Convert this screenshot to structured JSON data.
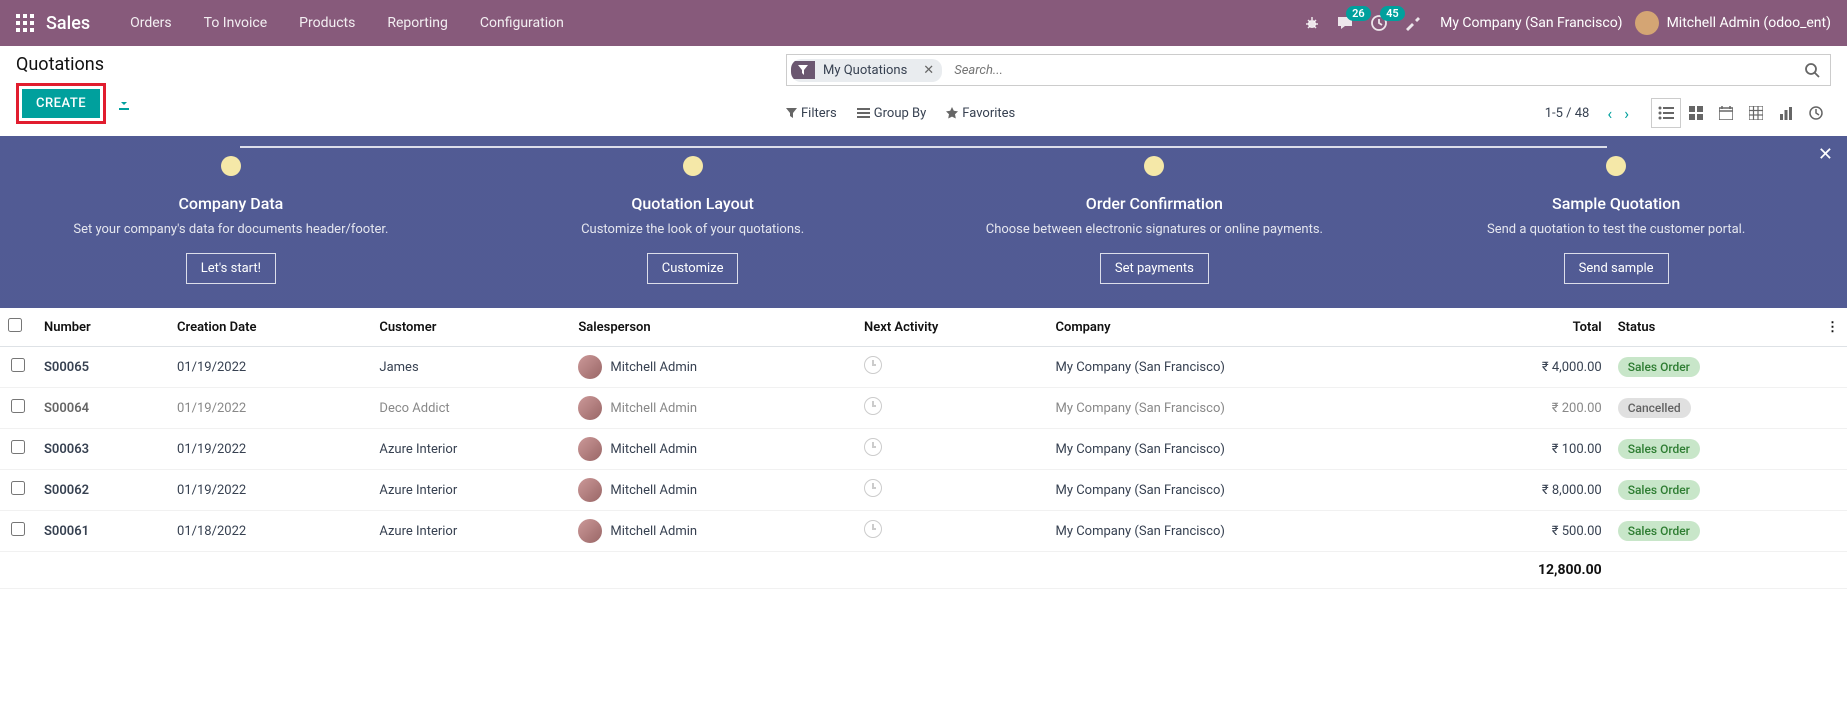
{
  "topnav": {
    "brand": "Sales",
    "menu": [
      "Orders",
      "To Invoice",
      "Products",
      "Reporting",
      "Configuration"
    ],
    "messages_badge": "26",
    "activities_badge": "45",
    "company": "My Company (San Francisco)",
    "user": "Mitchell Admin (odoo_ent)"
  },
  "cp": {
    "title": "Quotations",
    "create": "CREATE"
  },
  "search": {
    "chip": "My Quotations",
    "placeholder": "Search..."
  },
  "filters": {
    "filters": "Filters",
    "groupby": "Group By",
    "favorites": "Favorites",
    "pager": "1-5 / 48"
  },
  "onboard": {
    "steps": [
      {
        "title": "Company Data",
        "desc": "Set your company's data for documents header/footer.",
        "btn": "Let's start!"
      },
      {
        "title": "Quotation Layout",
        "desc": "Customize the look of your quotations.",
        "btn": "Customize"
      },
      {
        "title": "Order Confirmation",
        "desc": "Choose between electronic signatures or online payments.",
        "btn": "Set payments"
      },
      {
        "title": "Sample Quotation",
        "desc": "Send a quotation to test the customer portal.",
        "btn": "Send sample"
      }
    ]
  },
  "table": {
    "headers": {
      "number": "Number",
      "creation_date": "Creation Date",
      "customer": "Customer",
      "salesperson": "Salesperson",
      "next_activity": "Next Activity",
      "company": "Company",
      "total": "Total",
      "status": "Status"
    },
    "rows": [
      {
        "number": "S00065",
        "date": "01/19/2022",
        "customer": "James",
        "salesperson": "Mitchell Admin",
        "company": "My Company (San Francisco)",
        "total": "₹ 4,000.00",
        "status": "Sales Order",
        "status_class": "status-sales",
        "muted": false
      },
      {
        "number": "S00064",
        "date": "01/19/2022",
        "customer": "Deco Addict",
        "salesperson": "Mitchell Admin",
        "company": "My Company (San Francisco)",
        "total": "₹ 200.00",
        "status": "Cancelled",
        "status_class": "status-cancelled",
        "muted": true
      },
      {
        "number": "S00063",
        "date": "01/19/2022",
        "customer": "Azure Interior",
        "salesperson": "Mitchell Admin",
        "company": "My Company (San Francisco)",
        "total": "₹ 100.00",
        "status": "Sales Order",
        "status_class": "status-sales",
        "muted": false
      },
      {
        "number": "S00062",
        "date": "01/19/2022",
        "customer": "Azure Interior",
        "salesperson": "Mitchell Admin",
        "company": "My Company (San Francisco)",
        "total": "₹ 8,000.00",
        "status": "Sales Order",
        "status_class": "status-sales",
        "muted": false
      },
      {
        "number": "S00061",
        "date": "01/18/2022",
        "customer": "Azure Interior",
        "salesperson": "Mitchell Admin",
        "company": "My Company (San Francisco)",
        "total": "₹ 500.00",
        "status": "Sales Order",
        "status_class": "status-sales",
        "muted": false
      }
    ],
    "footer_total": "12,800.00"
  }
}
